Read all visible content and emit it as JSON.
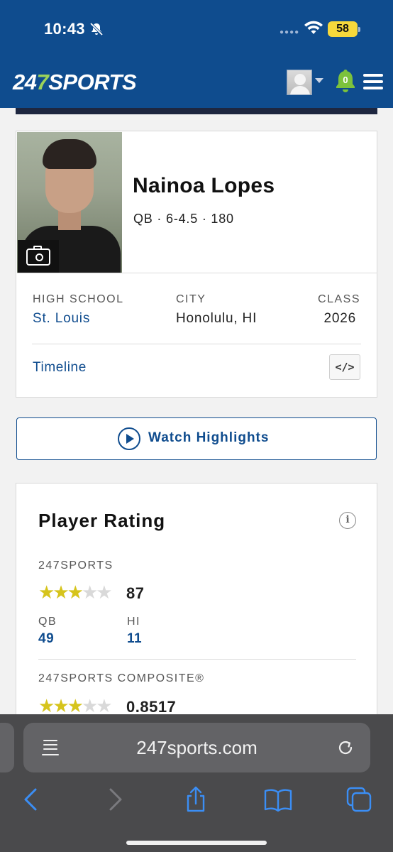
{
  "status_bar": {
    "time": "10:43",
    "battery": "58"
  },
  "header": {
    "logo_prefix": "24",
    "logo_seven": "7",
    "logo_suffix": "SPORTS",
    "notification_count": "0"
  },
  "player": {
    "name": "Nainoa Lopes",
    "meta": "QB · 6-4.5 · 180",
    "high_school_label": "HIGH SCHOOL",
    "high_school": "St. Louis",
    "city_label": "CITY",
    "city": "Honolulu, HI",
    "class_label": "CLASS",
    "class": "2026",
    "timeline_label": "Timeline",
    "embed_label": "</>"
  },
  "highlights": {
    "label": "Watch Highlights"
  },
  "rating": {
    "title": "Player Rating",
    "info_glyph": "i",
    "sports247_label": "247SPORTS",
    "sports247_stars": 3,
    "sports247_score": "87",
    "position_label": "QB",
    "position_rank": "49",
    "state_label": "HI",
    "state_rank": "11",
    "composite_label": "247SPORTS COMPOSITE®",
    "composite_stars": 3,
    "composite_score": "0.8517"
  },
  "safari": {
    "url": "247sports.com"
  },
  "icons": [
    "bell-slash-icon",
    "wifi-icon",
    "menu-icon",
    "camera-icon",
    "play-icon",
    "info-icon",
    "reader-icon",
    "reload-icon",
    "back-icon",
    "forward-icon",
    "share-icon",
    "bookmarks-icon",
    "tabs-icon"
  ],
  "colors": {
    "brand_blue": "#0f4c8e",
    "star_gold": "#d6c41c",
    "logo_green": "#9bd25a"
  }
}
